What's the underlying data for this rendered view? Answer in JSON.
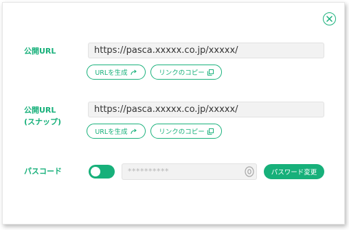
{
  "colors": {
    "accent": "#17b07a",
    "field_bg": "#f2f2f2"
  },
  "close_icon": "close-icon",
  "public_url": {
    "label": "公開URL",
    "value": "https://pasca.xxxxx.co.jp/xxxxx/",
    "generate_label": "URLを生成",
    "generate_icon": "share-arrow-icon",
    "copy_label": "リンクのコピー",
    "copy_icon": "copy-icon"
  },
  "snapshot_url": {
    "label_line1": "公開URL",
    "label_line2": "(スナップ)",
    "value": "https://pasca.xxxxx.co.jp/xxxxx/",
    "generate_label": "URLを生成",
    "generate_icon": "share-arrow-icon",
    "copy_label": "リンクのコピー",
    "copy_icon": "copy-icon"
  },
  "passcode": {
    "label": "パスコード",
    "toggle_on": true,
    "masked_value": "**********",
    "visibility_icon": "eye-icon",
    "change_button_label": "パスワード変更"
  }
}
